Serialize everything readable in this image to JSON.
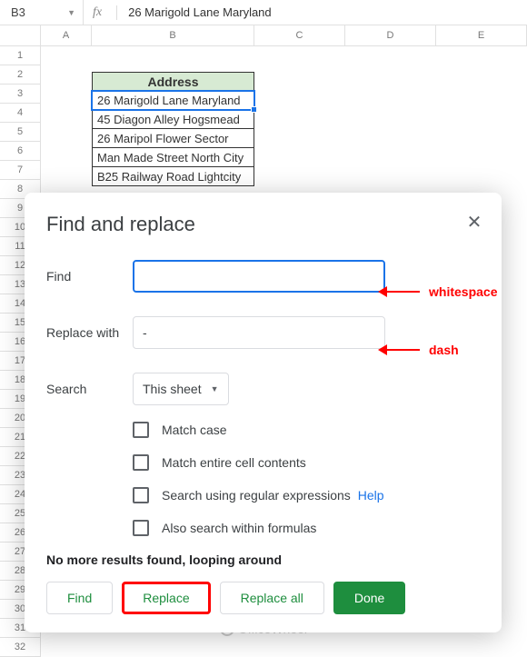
{
  "formula_bar": {
    "cell_ref": "B3",
    "value": "26 Marigold Lane Maryland"
  },
  "columns": [
    "A",
    "B",
    "C",
    "D",
    "E"
  ],
  "row_labels": [
    "1",
    "2",
    "3",
    "4",
    "5",
    "6",
    "7",
    "8",
    "9",
    "10",
    "11",
    "12",
    "13",
    "14",
    "15",
    "16",
    "17",
    "18",
    "19",
    "20",
    "21",
    "22",
    "23",
    "24",
    "25",
    "26",
    "27",
    "28",
    "29",
    "30",
    "31",
    "32"
  ],
  "table": {
    "header": "Address",
    "rows": [
      "26 Marigold Lane Maryland",
      "45 Diagon Alley Hogsmead",
      "26 Maripol Flower Sector",
      "Man Made Street North City",
      "B25 Railway Road Lightcity"
    ],
    "selected_index": 0
  },
  "dialog": {
    "title": "Find and replace",
    "find_label": "Find",
    "find_value": "",
    "replace_label": "Replace with",
    "replace_value": "-",
    "search_label": "Search",
    "search_scope": "This sheet",
    "checkboxes": {
      "match_case": "Match case",
      "match_entire": "Match entire cell contents",
      "regex": "Search using regular expressions",
      "help": "Help",
      "search_formulas": "Also search within formulas"
    },
    "status": "No more results found, looping around",
    "buttons": {
      "find": "Find",
      "replace": "Replace",
      "replace_all": "Replace all",
      "done": "Done"
    }
  },
  "annotations": {
    "find": "whitespace",
    "replace": "dash"
  },
  "watermark": "OfficeWheel"
}
